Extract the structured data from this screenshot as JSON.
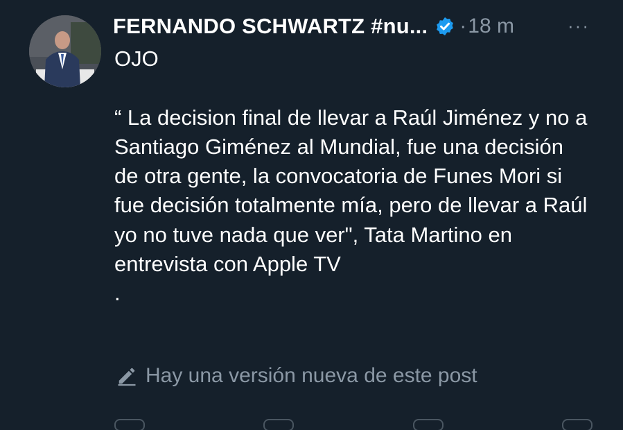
{
  "post": {
    "author_name": "FERNANDO SCHWARTZ #nu...",
    "separator": "·",
    "time": "18 m",
    "more_icon": "···",
    "body": "OJO\n\n“ La decision final de llevar a Raúl Jiménez y no a Santiago Giménez al Mundial, fue una decisión de otra gente, la convocatoria de Funes Mori si fue decisión totalmente mía, pero de llevar a Raúl yo no tuve nada que ver\", Tata Martino en entrevista con Apple TV\n.",
    "edit_note": "Hay una versión nueva de este post",
    "verified_color": "#1d9bf0"
  },
  "icons": {
    "verified": "verified-badge-icon",
    "more": "more-options-icon",
    "edit": "edit-pencil-icon"
  },
  "colors": {
    "background": "#15202b",
    "text_primary": "#ffffff",
    "text_secondary": "#8b98a5"
  }
}
